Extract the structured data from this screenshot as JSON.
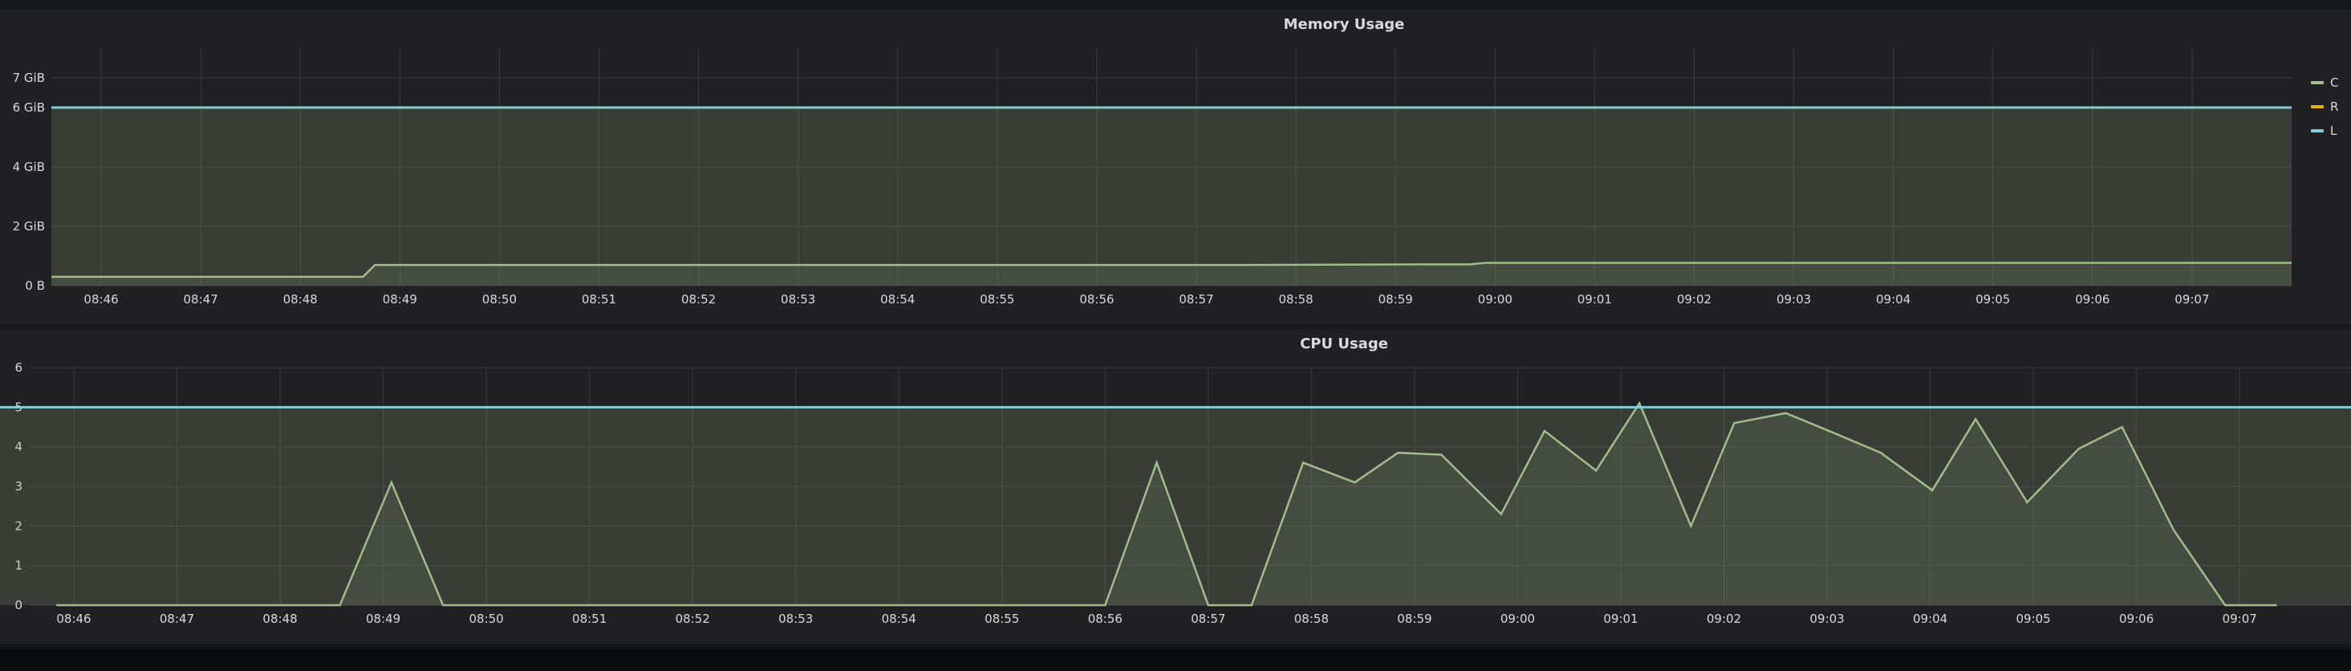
{
  "colors": {
    "series": "#a3be8c",
    "limit": "#86cbd8",
    "request": "#e5ac0e",
    "grid": "#3a3a3e",
    "text": "#d8d9da"
  },
  "legend": [
    {
      "label": "C",
      "color": "#a3be8c"
    },
    {
      "label": "R",
      "color": "#e5ac0e"
    },
    {
      "label": "L",
      "color": "#86cbd8"
    }
  ],
  "chart_data": [
    {
      "title": "Memory Usage",
      "type": "area",
      "xlabel": "",
      "ylabel": "",
      "x_ticks": [
        "08:46",
        "08:47",
        "08:48",
        "08:49",
        "08:50",
        "08:51",
        "08:52",
        "08:53",
        "08:54",
        "08:55",
        "08:56",
        "08:57",
        "08:58",
        "08:59",
        "09:00",
        "09:01",
        "09:02",
        "09:03",
        "09:04",
        "09:05",
        "09:06",
        "09:07"
      ],
      "x_range": [
        "08:45:30",
        "09:08"
      ],
      "y_ticks": [
        "0 B",
        "2 GiB",
        "4 GiB",
        "6 GiB",
        "7 GiB"
      ],
      "y_unit": "GiB",
      "ylim": [
        0,
        8
      ],
      "grid": true,
      "series": [
        {
          "values": [
            [
              0,
              0.3
            ],
            [
              0.75,
              0.3
            ],
            [
              1.57,
              0.3
            ],
            [
              2.46,
              0.3
            ],
            [
              3.13,
              0.3
            ],
            [
              3.25,
              0.7
            ],
            [
              4.0,
              0.7
            ],
            [
              6.0,
              0.7
            ],
            [
              8.0,
              0.7
            ],
            [
              10.0,
              0.7
            ],
            [
              12.0,
              0.7
            ],
            [
              14.0,
              0.72
            ],
            [
              14.25,
              0.72
            ],
            [
              14.4,
              0.77
            ],
            [
              15.0,
              0.77
            ],
            [
              17.0,
              0.77
            ],
            [
              19.0,
              0.77
            ],
            [
              21.0,
              0.77
            ],
            [
              22.5,
              0.77
            ]
          ]
        },
        {
          "values": [
            [
              0,
              6
            ],
            [
              22.5,
              6
            ]
          ]
        }
      ]
    },
    {
      "title": "CPU Usage",
      "type": "area",
      "xlabel": "",
      "ylabel": "",
      "x_ticks": [
        "08:46",
        "08:47",
        "08:48",
        "08:49",
        "08:50",
        "08:51",
        "08:52",
        "08:53",
        "08:54",
        "08:55",
        "08:56",
        "08:57",
        "08:58",
        "08:59",
        "09:00",
        "09:01",
        "09:02",
        "09:03",
        "09:04",
        "09:05",
        "09:06",
        "09:07"
      ],
      "x_range": [
        "08:45:35",
        "09:08"
      ],
      "y_ticks": [
        "0",
        "1",
        "2",
        "3",
        "4",
        "5",
        "6"
      ],
      "ylim": [
        0,
        6
      ],
      "grid": true,
      "series": [
        {
          "values": [
            [
              0.25,
              0
            ],
            [
              3.0,
              0
            ],
            [
              3.5,
              3.1
            ],
            [
              4.0,
              0
            ],
            [
              7.5,
              0
            ],
            [
              10.0,
              0
            ],
            [
              10.42,
              0
            ],
            [
              10.92,
              3.6
            ],
            [
              11.42,
              0
            ],
            [
              11.84,
              0
            ],
            [
              12.34,
              3.6
            ],
            [
              12.84,
              3.1
            ],
            [
              13.26,
              3.85
            ],
            [
              13.68,
              3.8
            ],
            [
              14.26,
              2.3
            ],
            [
              14.68,
              4.4
            ],
            [
              15.18,
              3.4
            ],
            [
              15.6,
              5.1
            ],
            [
              16.1,
              2.0
            ],
            [
              16.52,
              4.6
            ],
            [
              17.02,
              4.85
            ],
            [
              17.44,
              4.4
            ],
            [
              17.94,
              3.85
            ],
            [
              18.44,
              2.9
            ],
            [
              18.86,
              4.7
            ],
            [
              19.36,
              2.6
            ],
            [
              19.86,
              3.95
            ],
            [
              20.28,
              4.5
            ],
            [
              20.78,
              1.9
            ],
            [
              21.28,
              0
            ],
            [
              21.78,
              0
            ]
          ]
        },
        {
          "values": [
            [
              -0.6,
              5
            ],
            [
              22.5,
              5
            ]
          ]
        }
      ]
    }
  ]
}
